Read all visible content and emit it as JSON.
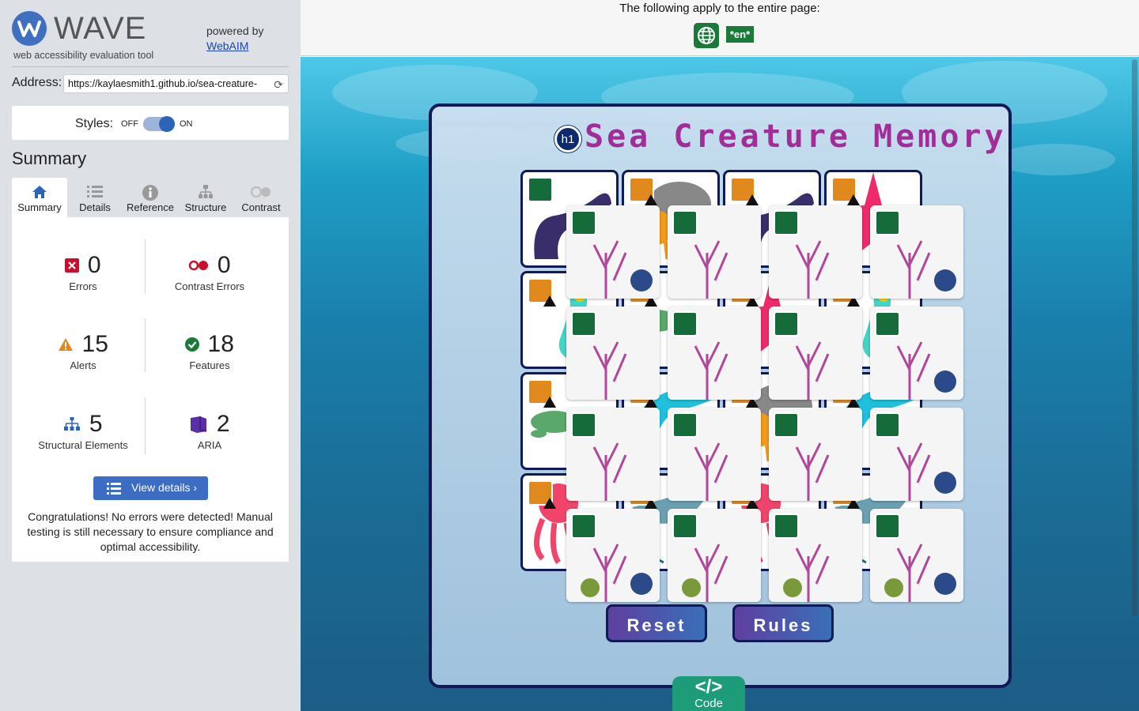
{
  "wave": {
    "logo_text": "WAVE",
    "tagline": "web accessibility evaluation tool",
    "powered_by": "powered by",
    "webaim_link": "WebAIM"
  },
  "address": {
    "label": "Address:",
    "value": "https://kaylaesmith1.github.io/sea-creature-"
  },
  "styles": {
    "label": "Styles:",
    "off": "OFF",
    "on": "ON",
    "enabled": true
  },
  "summary_heading": "Summary",
  "tabs": [
    {
      "label": "Summary",
      "icon": "home-icon",
      "active": true
    },
    {
      "label": "Details",
      "icon": "list-icon",
      "active": false
    },
    {
      "label": "Reference",
      "icon": "info-icon",
      "active": false
    },
    {
      "label": "Structure",
      "icon": "structure-icon",
      "active": false
    },
    {
      "label": "Contrast",
      "icon": "contrast-icon",
      "active": false
    }
  ],
  "stats": {
    "errors": {
      "count": "0",
      "label": "Errors",
      "color": "#c8102e"
    },
    "contrast_errors": {
      "count": "0",
      "label": "Contrast Errors",
      "color": "#c8102e"
    },
    "alerts": {
      "count": "15",
      "label": "Alerts",
      "color": "#e08a1c"
    },
    "features": {
      "count": "18",
      "label": "Features",
      "color": "#1b7a3a"
    },
    "structural": {
      "count": "5",
      "label": "Structural Elements",
      "color": "#2e64b8"
    },
    "aria": {
      "count": "2",
      "label": "ARIA",
      "color": "#5a2ea6"
    }
  },
  "view_details": "View details ›",
  "congrats": "Congratulations! No errors were detected! Manual testing is still necessary to ensure compliance and optimal accessibility.",
  "topbar": {
    "text": "The following apply to the entire page:",
    "lang_badge": "*en*"
  },
  "page": {
    "h1_badge": "h1",
    "title": "Sea Creature Memory",
    "reset_label": "Reset",
    "rules_label": "Rules",
    "code_label": "Code",
    "code_glyph": "</>"
  },
  "colors": {
    "wave_blue": "#3f6fbf",
    "feature_green": "#1b7a3a",
    "alert_orange": "#e08a1c",
    "title_purple": "#a12e98",
    "board_border": "#101a57"
  }
}
